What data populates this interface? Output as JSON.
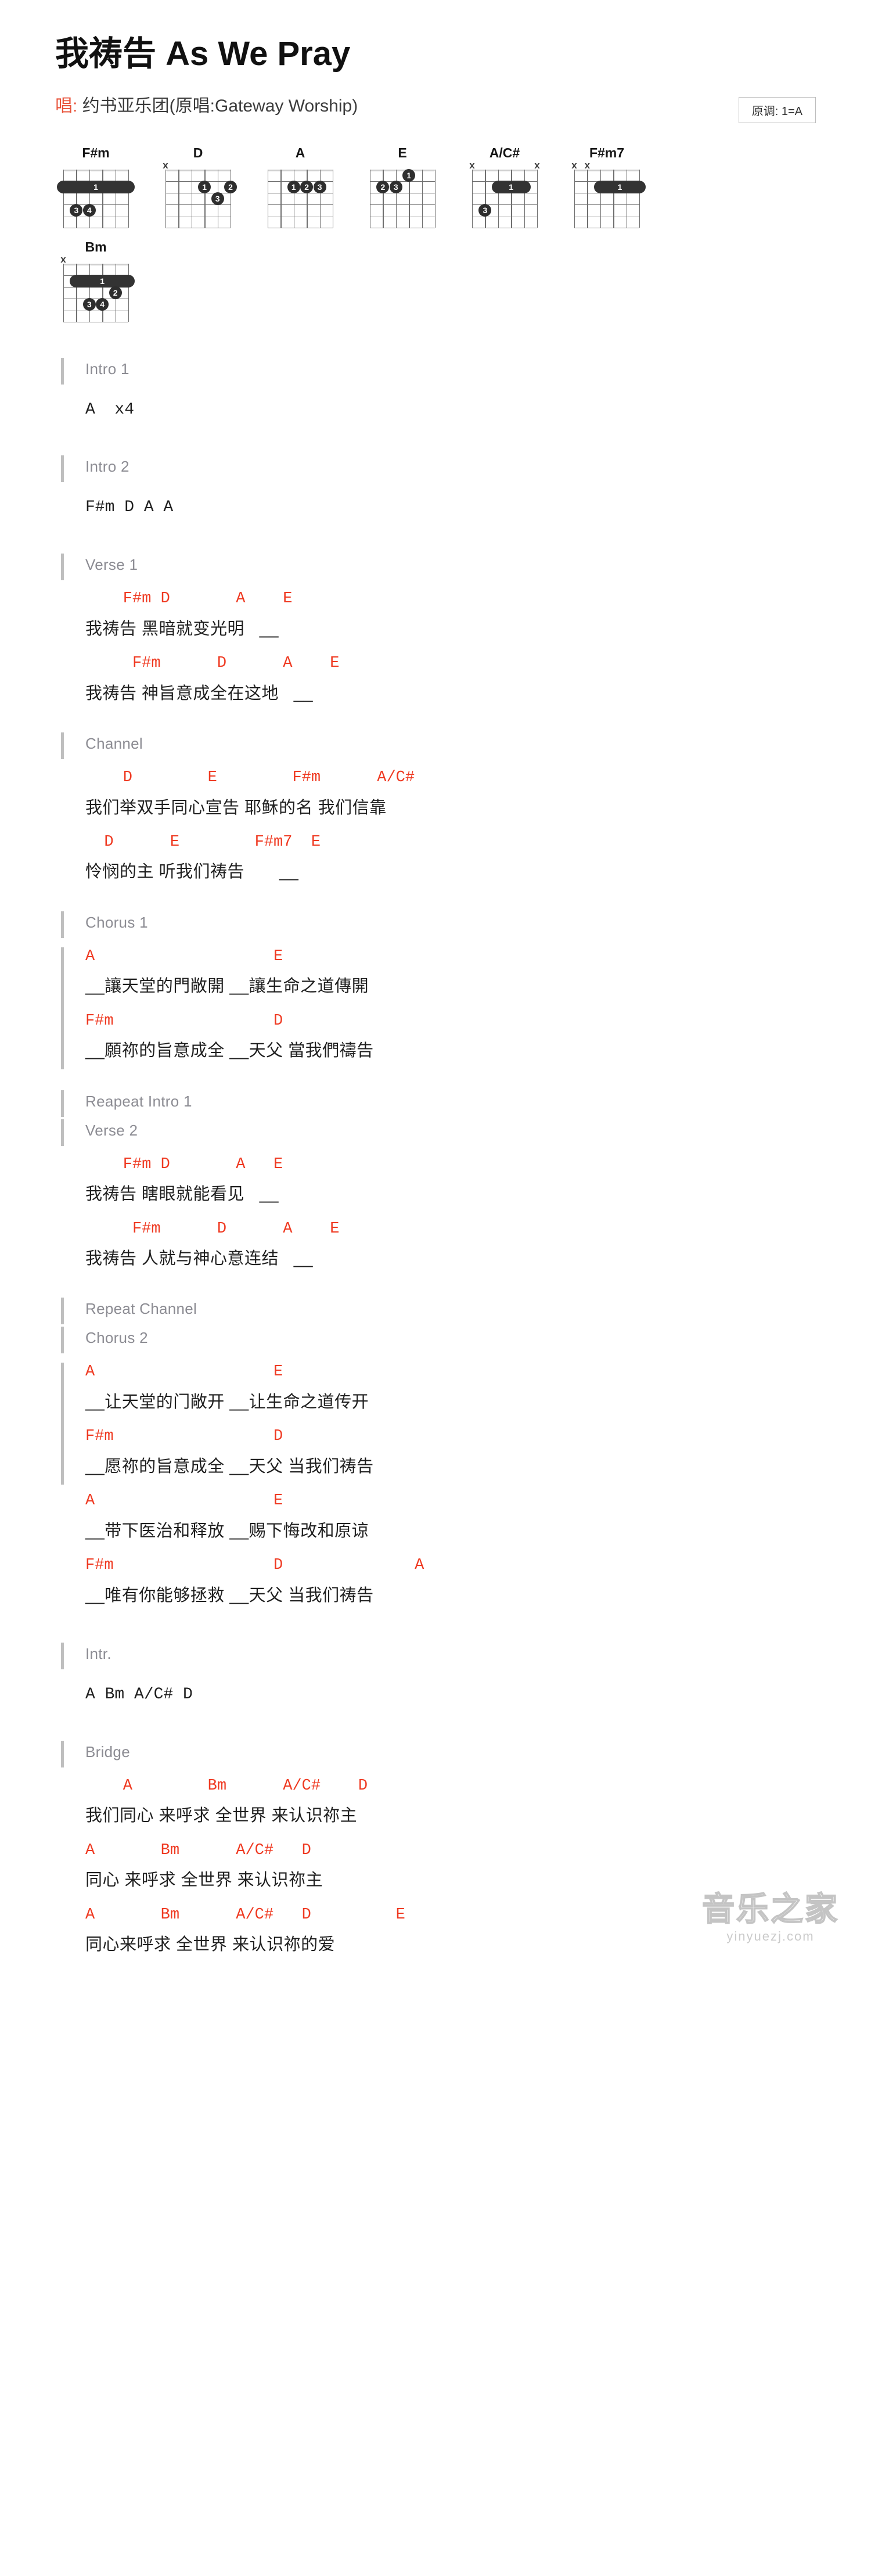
{
  "header": {
    "title": "我祷告 As We Pray",
    "sing_label": "唱:",
    "artist": "约书亚乐团(原唱:Gateway Worship)",
    "key_badge": "原调: 1=A"
  },
  "chords": [
    {
      "name": "F#m",
      "marks": [],
      "barre": {
        "fret": 2,
        "from_string": 1,
        "to_string": 6,
        "finger": "1"
      },
      "dots": [
        {
          "string": 5,
          "fret": 4,
          "finger": "3"
        },
        {
          "string": 4,
          "fret": 4,
          "finger": "4"
        }
      ]
    },
    {
      "name": "D",
      "marks": [
        {
          "string": 6,
          "symbol": "x"
        }
      ],
      "barre": null,
      "dots": [
        {
          "string": 3,
          "fret": 2,
          "finger": "1"
        },
        {
          "string": 1,
          "fret": 2,
          "finger": "2"
        },
        {
          "string": 2,
          "fret": 3,
          "finger": "3"
        }
      ]
    },
    {
      "name": "A",
      "marks": [],
      "barre": null,
      "dots": [
        {
          "string": 4,
          "fret": 2,
          "finger": "1"
        },
        {
          "string": 3,
          "fret": 2,
          "finger": "2"
        },
        {
          "string": 2,
          "fret": 2,
          "finger": "3"
        }
      ]
    },
    {
      "name": "E",
      "marks": [],
      "barre": null,
      "dots": [
        {
          "string": 3,
          "fret": 1,
          "finger": "1"
        },
        {
          "string": 5,
          "fret": 2,
          "finger": "2"
        },
        {
          "string": 4,
          "fret": 2,
          "finger": "3"
        }
      ]
    },
    {
      "name": "A/C#",
      "marks": [
        {
          "string": 6,
          "symbol": "x"
        },
        {
          "string": 1,
          "symbol": "x"
        }
      ],
      "barre": {
        "fret": 2,
        "from_string": 4,
        "to_string": 2,
        "finger": "1"
      },
      "dots": [
        {
          "string": 5,
          "fret": 4,
          "finger": "3"
        }
      ]
    },
    {
      "name": "F#m7",
      "marks": [
        {
          "string": 6,
          "symbol": "x"
        },
        {
          "string": 5,
          "symbol": "x"
        }
      ],
      "barre": {
        "fret": 2,
        "from_string": 4,
        "to_string": 1,
        "finger": "1"
      },
      "dots": []
    },
    {
      "name": "Bm",
      "marks": [
        {
          "string": 6,
          "symbol": "x"
        }
      ],
      "barre": {
        "fret": 2,
        "from_string": 5,
        "to_string": 1,
        "finger": "1"
      },
      "dots": [
        {
          "string": 2,
          "fret": 3,
          "finger": "2"
        },
        {
          "string": 4,
          "fret": 4,
          "finger": "3"
        },
        {
          "string": 3,
          "fret": 4,
          "finger": "4"
        }
      ]
    }
  ],
  "sections": {
    "intro1": {
      "label": "Intro 1",
      "line": "A  x4"
    },
    "intro2": {
      "label": "Intro 2",
      "line": "F#m D A A"
    },
    "verse1": {
      "label": "Verse 1",
      "chord1": "    F#m D       A    E",
      "lyric1": "我祷告 黑暗就变光明   __",
      "chord2": "     F#m      D      A    E",
      "lyric2": "我祷告 神旨意成全在这地   __"
    },
    "channel": {
      "label": "Channel",
      "chord1": "    D        E        F#m      A/C#",
      "lyric1": "我们举双手同心宣告 耶稣的名 我们信靠",
      "chord2": "  D      E        F#m7  E",
      "lyric2": "怜悯的主 听我们祷告       __"
    },
    "chorus1": {
      "label": "Chorus 1",
      "chord1": "A                   E",
      "lyric1": "__讓天堂的門敞開 __讓生命之道傳開",
      "chord2": "F#m                 D",
      "lyric2": "__願祢的旨意成全 __天父 當我們禱告"
    },
    "repeat_intro1": {
      "label": "Reapeat Intro 1"
    },
    "verse2": {
      "label": "Verse 2",
      "chord1": "    F#m D       A   E",
      "lyric1": "我祷告 瞎眼就能看见   __",
      "chord2": "     F#m      D      A    E",
      "lyric2": "我祷告 人就与神心意连结   __"
    },
    "repeat_channel": {
      "label": "Repeat Channel"
    },
    "chorus2": {
      "label": "Chorus 2",
      "chord1": "A                   E",
      "lyric1": "__让天堂的门敞开 __让生命之道传开",
      "chord2": "F#m                 D",
      "lyric2": "__愿祢的旨意成全 __天父 当我们祷告",
      "chord3": "A                   E",
      "lyric3": "__带下医治和释放 __赐下悔改和原谅",
      "chord4": "F#m                 D              A",
      "lyric4": "__唯有你能够拯救 __天父 当我们祷告"
    },
    "intr": {
      "label": "Intr.",
      "line": "A Bm A/C# D"
    },
    "bridge": {
      "label": "Bridge",
      "chord1": "    A        Bm      A/C#    D",
      "lyric1": "我们同心 来呼求 全世界 来认识祢主",
      "chord2": "A       Bm      A/C#   D",
      "lyric2": "同心 来呼求 全世界 来认识祢主",
      "chord3": "A       Bm      A/C#   D         E",
      "lyric3": "同心来呼求 全世界 来认识祢的爱"
    }
  },
  "watermark": {
    "cn": "音乐之家",
    "en": "yinyuezj.com"
  },
  "colors": {
    "chord_red": "#ef3a22",
    "section_gray": "#8c8c93",
    "accent_orange": "#e8533a"
  }
}
